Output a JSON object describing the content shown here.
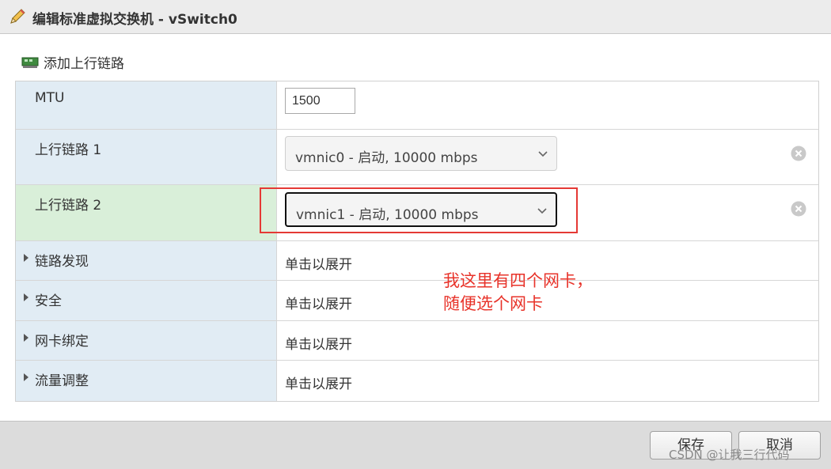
{
  "dialog": {
    "title": "编辑标准虚拟交换机 - vSwitch0"
  },
  "toolbar": {
    "add_uplink_label": "添加上行链路"
  },
  "rows": {
    "mtu": {
      "label": "MTU",
      "value": "1500"
    },
    "uplink1": {
      "label": "上行链路 1",
      "selected": "vmnic0 - 启动, 10000 mbps"
    },
    "uplink2": {
      "label": "上行链路 2",
      "selected": "vmnic1 - 启动, 10000 mbps"
    },
    "discovery": {
      "label": "链路发现",
      "value": "单击以展开"
    },
    "security": {
      "label": "安全",
      "value": "单击以展开"
    },
    "teaming": {
      "label": "网卡绑定",
      "value": "单击以展开"
    },
    "shaping": {
      "label": "流量调整",
      "value": "单击以展开"
    }
  },
  "annotation": {
    "line1": "我这里有四个网卡，",
    "line2": "随便选个网卡",
    "color": "#e8332a"
  },
  "footer": {
    "save_label": "保存",
    "cancel_label": "取消"
  },
  "watermark": "CSDN @让我三行代码",
  "icons": {
    "title": "pencil-icon",
    "add": "nic-icon",
    "remove": "remove-circle-icon",
    "dropdown": "chevron-down-icon",
    "expand": "triangle-right-icon"
  }
}
